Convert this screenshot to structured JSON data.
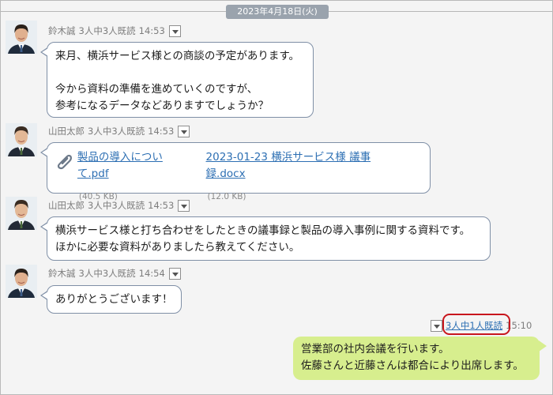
{
  "date_separator": "2023年4月18日(火)",
  "messages": [
    {
      "sender": "鈴木誠",
      "read_status": "3人中3人既読",
      "time": "14:53",
      "lines": [
        "来月、横浜サービス様との商談の予定があります。",
        "今から資料の準備を進めていくのですが、",
        "参考になるデータなどありますでしょうか？"
      ]
    },
    {
      "sender": "山田太郎",
      "read_status": "3人中3人既読",
      "time": "14:53",
      "attachments": [
        {
          "name": "製品の導入について.pdf",
          "size": "(40.5 KB)"
        },
        {
          "name": "2023-01-23 横浜サービス様 議事録.docx",
          "size": "(12.0 KB)"
        }
      ]
    },
    {
      "sender": "山田太郎",
      "read_status": "3人中3人既読",
      "time": "14:53",
      "lines": [
        "横浜サービス様と打ち合わせをしたときの議事録と製品の導入事例に関する資料です。",
        "ほかに必要な資料がありましたら教えてください。"
      ]
    },
    {
      "sender": "鈴木誠",
      "read_status": "3人中3人既読",
      "time": "14:54",
      "lines": [
        "ありがとうございます！"
      ]
    }
  ],
  "own_message": {
    "read_status": "3人中1人既読",
    "time": "15:10",
    "lines": [
      "営業部の社内会議を行います。",
      "佐藤さんと近藤さんは都合により出席します。"
    ]
  },
  "colors": {
    "own_bubble": "#d7ee8e",
    "link": "#2d6fb3",
    "highlight_ring": "#c8161d",
    "date_badge": "#9aa3ad"
  },
  "icons": {
    "avatar_suzuki": "avatar-man-icon",
    "avatar_yamada": "avatar-man-icon",
    "attachment": "paperclip-icon",
    "menu": "dropdown-arrow-icon"
  }
}
